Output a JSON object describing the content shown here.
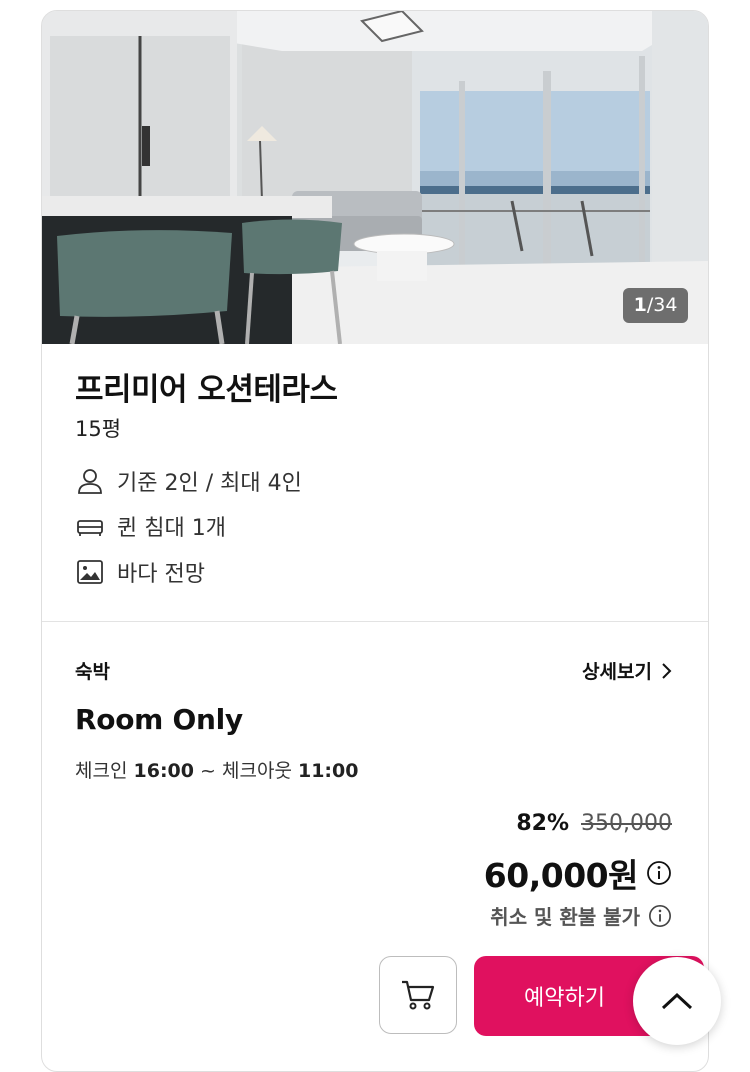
{
  "gallery": {
    "current": "1",
    "total": "/34"
  },
  "room": {
    "name": "프리미어 오션테라스",
    "size": "15평",
    "features": [
      {
        "icon": "person-icon",
        "label": "기준 2인 / 최대 4인"
      },
      {
        "icon": "bed-icon",
        "label": "퀸 침대 1개"
      },
      {
        "icon": "image-icon",
        "label": "바다 전망"
      }
    ]
  },
  "offer": {
    "stay_type": "숙박",
    "detail_link": "상세보기",
    "plan_name": "Room Only",
    "checkin_label": "체크인",
    "checkin_time": "16:00",
    "separator": "~",
    "checkout_label": "체크아웃",
    "checkout_time": "11:00",
    "discount": "82%",
    "original_price": "350,000",
    "price": "60,000원",
    "refund_policy": "취소 및 환불 불가",
    "book_label": "예약하기"
  },
  "colors": {
    "accent": "#e0115f",
    "border": "#dedede"
  }
}
